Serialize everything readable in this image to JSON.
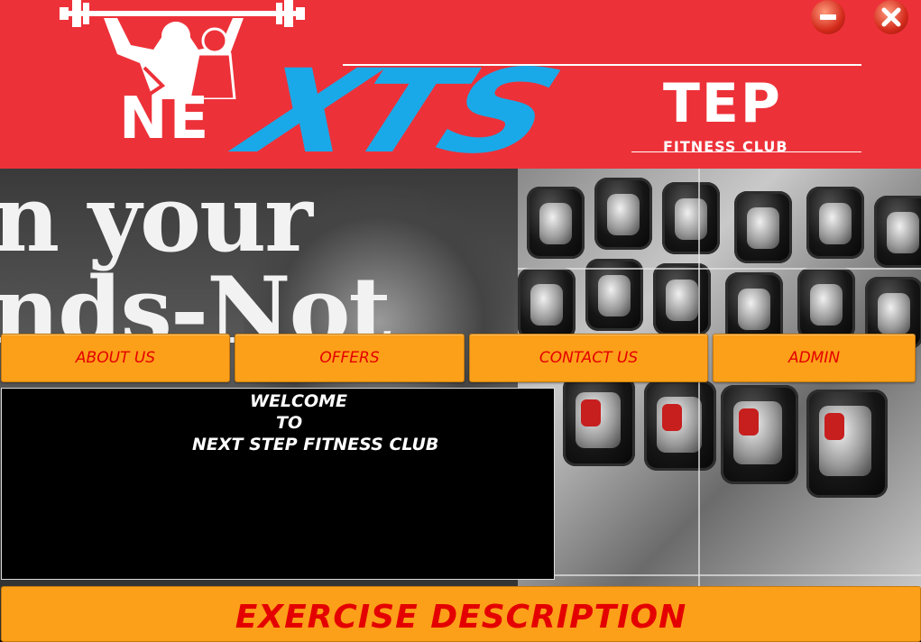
{
  "header": {
    "logo": {
      "word_left": "NE",
      "word_middle": "XTS",
      "word_right": "TEP",
      "tagline": "FITNESS CLUB"
    },
    "window_controls": {
      "minimize_icon": "minus-circle-icon",
      "close_icon": "x-circle-icon"
    },
    "colors": {
      "background": "#ed3139",
      "accent_blue": "#1aa9e8"
    }
  },
  "banner": {
    "text": "n your\nnds-Not"
  },
  "nav": {
    "items": [
      {
        "label": "ABOUT US"
      },
      {
        "label": "OFFERS"
      },
      {
        "label": "CONTACT US"
      },
      {
        "label": "ADMIN"
      }
    ],
    "colors": {
      "button_bg": "#fc9f19",
      "text": "#e40000"
    }
  },
  "welcome": {
    "line1": "WELCOME",
    "line2": "TO",
    "line3": "NEXT STEP FITNESS CLUB"
  },
  "exercise": {
    "label": "EXERCISE DESCRIPTION"
  }
}
